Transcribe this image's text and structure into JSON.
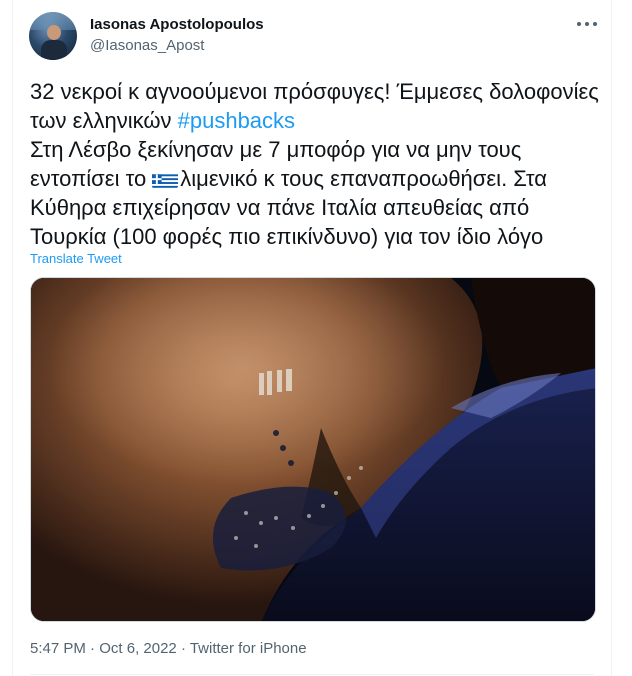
{
  "author": {
    "name": "Iasonas Apostolopoulos",
    "handle": "@Iasonas_Apost",
    "avatar_icon": "profile-photo"
  },
  "menu": {
    "more_icon": "more-horizontal-icon"
  },
  "tweet": {
    "line1_text": "32 νεκροί κ αγνοούμενοι πρόσφυγες! Έμμεσες δολοφονίες  των ελληνικών ",
    "hashtag": "#pushbacks",
    "line2_before_flag": "Στη Λέσβο ξεκίνησαν με 7 μποφόρ για να μην τους εντοπίσει το ",
    "flag_icon": "greek-flag-emoji",
    "line2_after_flag": "λιμενικό κ τους επαναπροωθήσει. Στα Κύθηρα επιχείρησαν να πάνε Ιταλία απευθείας από Τουρκία (100 φορές πιο επικίνδυνο) για τον ίδιο λόγο"
  },
  "translate_label": "Translate Tweet",
  "media": {
    "description_icon": "night-cliff-rescue-photo"
  },
  "meta": {
    "time": "5:47 PM",
    "separator1": " · ",
    "date": "Oct 6, 2022",
    "separator2": " · ",
    "source": "Twitter for iPhone"
  },
  "colors": {
    "link": "#1d9bf0",
    "text": "#0f1419",
    "secondary": "#536471"
  }
}
